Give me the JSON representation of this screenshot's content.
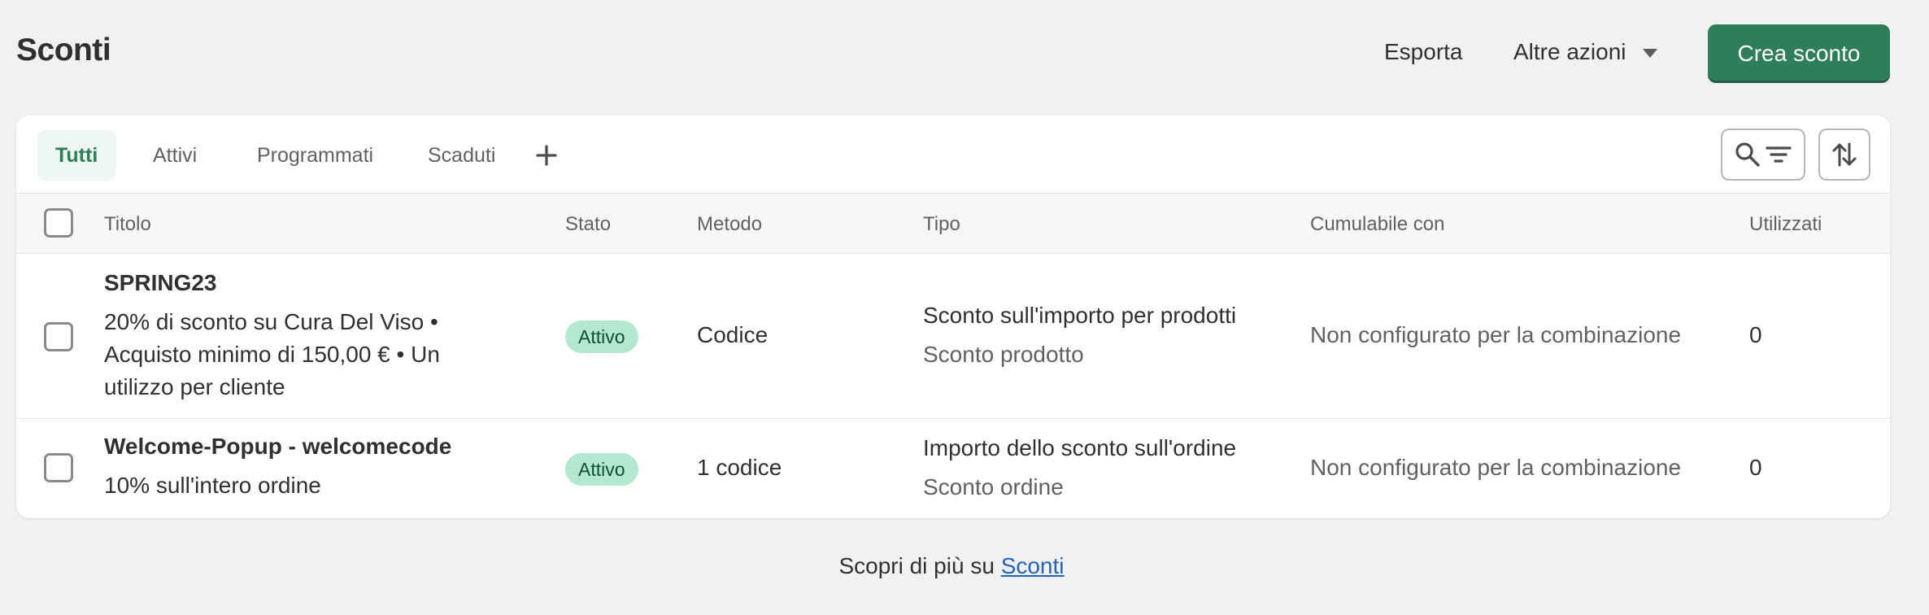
{
  "header": {
    "title": "Sconti",
    "export_label": "Esporta",
    "more_actions_label": "Altre azioni",
    "create_label": "Crea sconto"
  },
  "tabs": [
    {
      "label": "Tutti",
      "active": true
    },
    {
      "label": "Attivi",
      "active": false
    },
    {
      "label": "Programmati",
      "active": false
    },
    {
      "label": "Scaduti",
      "active": false
    }
  ],
  "add_tab_icon": "plus-icon",
  "toolbar_icons": {
    "search": "search-icon",
    "filter": "filter-icon",
    "sort": "sort-icon"
  },
  "table": {
    "columns": [
      "Titolo",
      "Stato",
      "Metodo",
      "Tipo",
      "Cumulabile con",
      "Utilizzati"
    ],
    "rows": [
      {
        "title": "SPRING23",
        "description": "20% di sconto su Cura Del Viso • Acquisto minimo di 150,00 € • Un utilizzo per cliente",
        "status": "Attivo",
        "method": "Codice",
        "type_main": "Sconto sull'importo per prodotti",
        "type_sub": "Sconto prodotto",
        "combinable": "Non configurato per la combinazione",
        "used": "0"
      },
      {
        "title": "Welcome-Popup - welcomecode",
        "description": "10% sull'intero ordine",
        "status": "Attivo",
        "method": "1 codice",
        "type_main": "Importo dello sconto sull'ordine",
        "type_sub": "Sconto ordine",
        "combinable": "Non configurato per la combinazione",
        "used": "0"
      }
    ]
  },
  "footer": {
    "text": "Scopri di più su",
    "link": "Sconti"
  },
  "colors": {
    "primary": "#2e7d5b",
    "badge_bg": "#b4e7cf",
    "badge_text": "#0c5132",
    "link": "#2463bc",
    "page_bg": "#f1f1f1"
  }
}
